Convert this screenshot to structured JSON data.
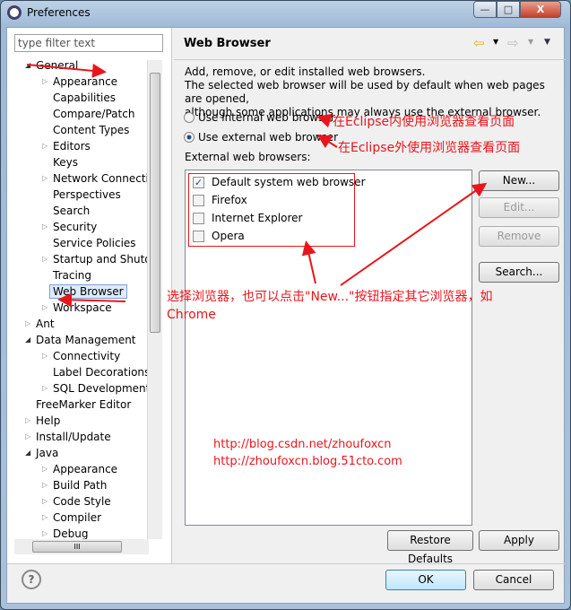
{
  "window": {
    "title": "Preferences",
    "minimize": "—",
    "maximize": "□",
    "close": "X"
  },
  "filter": {
    "placeholder": "type filter text"
  },
  "tree": [
    {
      "label": "General",
      "level": 0,
      "state": "expanded"
    },
    {
      "label": "Appearance",
      "level": 1,
      "state": "collapsed"
    },
    {
      "label": "Capabilities",
      "level": 1,
      "state": "leaf"
    },
    {
      "label": "Compare/Patch",
      "level": 1,
      "state": "leaf"
    },
    {
      "label": "Content Types",
      "level": 1,
      "state": "leaf"
    },
    {
      "label": "Editors",
      "level": 1,
      "state": "collapsed"
    },
    {
      "label": "Keys",
      "level": 1,
      "state": "leaf"
    },
    {
      "label": "Network Connection",
      "level": 1,
      "state": "collapsed"
    },
    {
      "label": "Perspectives",
      "level": 1,
      "state": "leaf"
    },
    {
      "label": "Search",
      "level": 1,
      "state": "leaf"
    },
    {
      "label": "Security",
      "level": 1,
      "state": "collapsed"
    },
    {
      "label": "Service Policies",
      "level": 1,
      "state": "leaf"
    },
    {
      "label": "Startup and Shutdown",
      "level": 1,
      "state": "collapsed"
    },
    {
      "label": "Tracing",
      "level": 1,
      "state": "leaf"
    },
    {
      "label": "Web Browser",
      "level": 1,
      "state": "leaf",
      "selected": true
    },
    {
      "label": "Workspace",
      "level": 1,
      "state": "collapsed"
    },
    {
      "label": "Ant",
      "level": 0,
      "state": "collapsed"
    },
    {
      "label": "Data Management",
      "level": 0,
      "state": "expanded"
    },
    {
      "label": "Connectivity",
      "level": 1,
      "state": "collapsed"
    },
    {
      "label": "Label Decorations",
      "level": 1,
      "state": "leaf"
    },
    {
      "label": "SQL Development",
      "level": 1,
      "state": "collapsed"
    },
    {
      "label": "FreeMarker Editor",
      "level": 0,
      "state": "leaf"
    },
    {
      "label": "Help",
      "level": 0,
      "state": "collapsed"
    },
    {
      "label": "Install/Update",
      "level": 0,
      "state": "collapsed"
    },
    {
      "label": "Java",
      "level": 0,
      "state": "expanded"
    },
    {
      "label": "Appearance",
      "level": 1,
      "state": "collapsed"
    },
    {
      "label": "Build Path",
      "level": 1,
      "state": "collapsed"
    },
    {
      "label": "Code Style",
      "level": 1,
      "state": "collapsed"
    },
    {
      "label": "Compiler",
      "level": 1,
      "state": "collapsed"
    },
    {
      "label": "Debug",
      "level": 1,
      "state": "collapsed"
    }
  ],
  "page": {
    "title": "Web Browser",
    "desc1": "Add, remove, or edit installed web browsers.",
    "desc2": "The selected web browser will be used by default when web pages are opened,",
    "desc3": "although some applications may always use the external browser.",
    "radio_internal": "Use internal web browser",
    "radio_external": "Use external web browser",
    "selected_radio": "external",
    "list_label": "External web browsers:",
    "browsers": [
      {
        "label": "Default system web browser",
        "checked": true
      },
      {
        "label": "Firefox",
        "checked": false
      },
      {
        "label": "Internet Explorer",
        "checked": false
      },
      {
        "label": "Opera",
        "checked": false
      }
    ],
    "buttons": {
      "new": "New...",
      "edit": "Edit...",
      "remove": "Remove",
      "search": "Search..."
    },
    "restore": "Restore Defaults",
    "apply": "Apply"
  },
  "footer": {
    "ok": "OK",
    "cancel": "Cancel",
    "help": "?"
  },
  "annotations": {
    "internal": "在Eclipse内使用浏览器查看页面",
    "external": "在Eclipse外使用浏览器查看页面",
    "select1": "选择浏览器，也可以点击\"New...\"按钮指定其它浏览器，如",
    "select2": "Chrome",
    "url1": "http://blog.csdn.net/zhoufoxcn",
    "url2": "http://zhoufoxcn.blog.51cto.com",
    "color": "#e8161c"
  }
}
